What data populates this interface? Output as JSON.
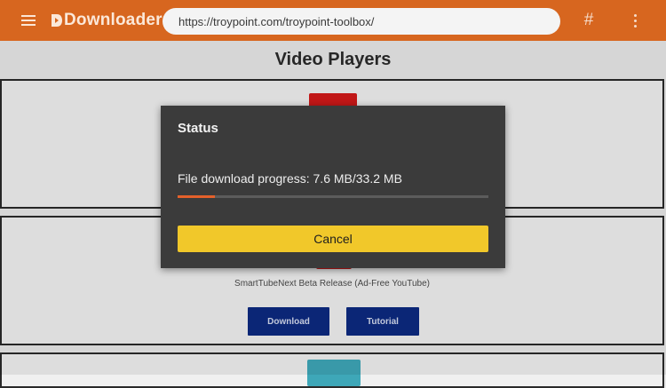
{
  "app": {
    "brand": "Downloader"
  },
  "toolbar": {
    "url": "https://troypoint.com/troypoint-toolbox/"
  },
  "page": {
    "title": "Video Players",
    "cards": [
      {
        "caption": "",
        "download_label": "",
        "tutorial_label": ""
      },
      {
        "caption": "SmartTubeNext Beta Release (Ad-Free YouTube)",
        "download_label": "Download",
        "tutorial_label": "Tutorial"
      }
    ]
  },
  "dialog": {
    "title": "Status",
    "message": "File download progress: 7.6 MB/33.2 MB",
    "progress_fraction": 0.12,
    "cancel_label": "Cancel"
  },
  "colors": {
    "accent": "#d7661f",
    "progress": "#e4602b",
    "cancel": "#f1c82a",
    "dialog_bg": "#3b3b3b"
  }
}
